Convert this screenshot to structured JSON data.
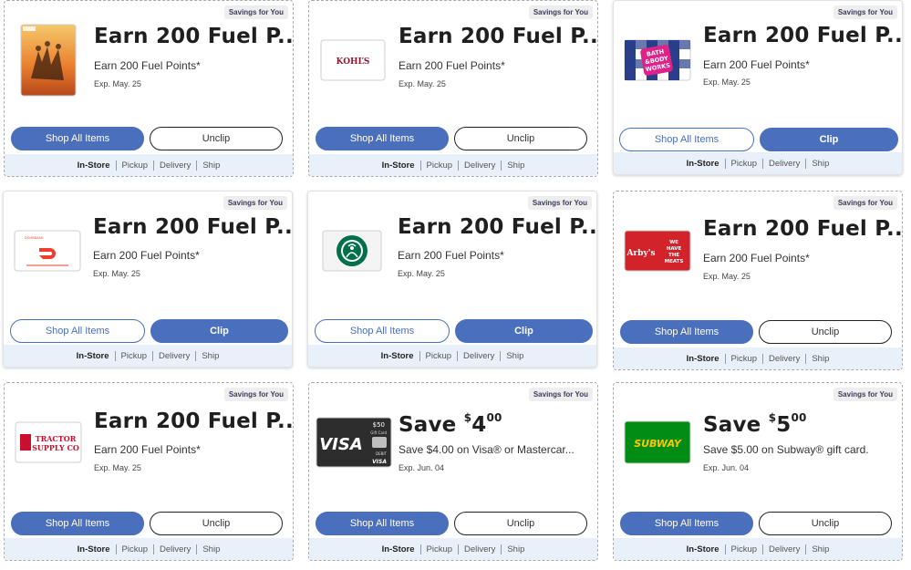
{
  "cards": [
    {
      "badge": "Savings for You",
      "logo": "visa-adventure-gift-card-icon",
      "title": "Earn 200 Fuel P...",
      "desc": "Earn 200 Fuel Points*",
      "exp": "Exp. May. 25",
      "shop": "Shop All Items",
      "action": "Unclip",
      "fulfillment": [
        "In-Store",
        "Pickup",
        "Delivery",
        "Ship"
      ]
    },
    {
      "badge": "Savings for You",
      "logo": "kohls-gift-card-icon",
      "logo_text": "KOHĽS",
      "title": "Earn 200 Fuel P...",
      "desc": "Earn 200 Fuel Points*",
      "exp": "Exp. May. 25",
      "shop": "Shop All Items",
      "action": "Unclip",
      "fulfillment": [
        "In-Store",
        "Pickup",
        "Delivery",
        "Ship"
      ]
    },
    {
      "badge": "Savings for You",
      "logo": "bath-body-works-gift-card-icon",
      "logo_text": [
        "BATH",
        "&BODY",
        "WORKS"
      ],
      "title": "Earn 200 Fuel P...",
      "desc": "Earn 200 Fuel Points*",
      "exp": "Exp. May. 25",
      "shop": "Shop All Items",
      "action": "Clip",
      "fulfillment": [
        "In-Store",
        "Pickup",
        "Delivery",
        "Ship"
      ]
    },
    {
      "badge": "Savings for You",
      "logo": "doordash-gift-card-icon",
      "logo_text": "DOORDASH",
      "title": "Earn 200 Fuel P...",
      "desc": "Earn 200 Fuel Points*",
      "exp": "Exp. May. 25",
      "shop": "Shop All Items",
      "action": "Clip",
      "fulfillment": [
        "In-Store",
        "Pickup",
        "Delivery",
        "Ship"
      ]
    },
    {
      "badge": "Savings for You",
      "logo": "starbucks-gift-card-icon",
      "title": "Earn 200 Fuel P...",
      "desc": "Earn 200 Fuel Points*",
      "exp": "Exp. May. 25",
      "shop": "Shop All Items",
      "action": "Clip",
      "fulfillment": [
        "In-Store",
        "Pickup",
        "Delivery",
        "Ship"
      ]
    },
    {
      "badge": "Savings for You",
      "logo": "arbys-gift-card-icon",
      "logo_text": [
        "Arby's",
        "WE",
        "HAVE",
        "THE",
        "MEATS"
      ],
      "title": "Earn 200 Fuel P...",
      "desc": "Earn 200 Fuel Points*",
      "exp": "Exp. May. 25",
      "shop": "Shop All Items",
      "action": "Unclip",
      "fulfillment": [
        "In-Store",
        "Pickup",
        "Delivery",
        "Ship"
      ]
    },
    {
      "badge": "Savings for You",
      "logo": "tractor-supply-gift-card-icon",
      "logo_text": [
        "TRACTOR",
        "SUPPLY CO"
      ],
      "title": "Earn 200 Fuel P...",
      "desc": "Earn 200 Fuel Points*",
      "exp": "Exp. May. 25",
      "shop": "Shop All Items",
      "action": "Unclip",
      "fulfillment": [
        "In-Store",
        "Pickup",
        "Delivery",
        "Ship"
      ]
    },
    {
      "badge": "Savings for You",
      "logo": "visa-gift-card-icon",
      "logo_text": [
        "VISA",
        "$50",
        "Gift Card",
        "DEBIT"
      ],
      "title_prefix": "Save ",
      "title_dollar": "$",
      "title_amount": "4",
      "title_cents": "00",
      "desc": "Save $4.00 on Visa® or Mastercar...",
      "exp": "Exp. Jun. 04",
      "shop": "Shop All Items",
      "action": "Unclip",
      "fulfillment": [
        "In-Store",
        "Pickup",
        "Delivery",
        "Ship"
      ]
    },
    {
      "badge": "Savings for You",
      "logo": "subway-gift-card-icon",
      "logo_text": "SUBWAY",
      "title_prefix": "Save ",
      "title_dollar": "$",
      "title_amount": "5",
      "title_cents": "00",
      "desc": "Save $5.00 on Subway® gift card.",
      "exp": "Exp. Jun. 04",
      "shop": "Shop All Items",
      "action": "Unclip",
      "fulfillment": [
        "In-Store",
        "Pickup",
        "Delivery",
        "Ship"
      ]
    }
  ],
  "colors": {
    "brand_blue": "#4a6fbd",
    "footer_bg": "#e8f1f9",
    "badge_bg": "#eeeeef"
  }
}
